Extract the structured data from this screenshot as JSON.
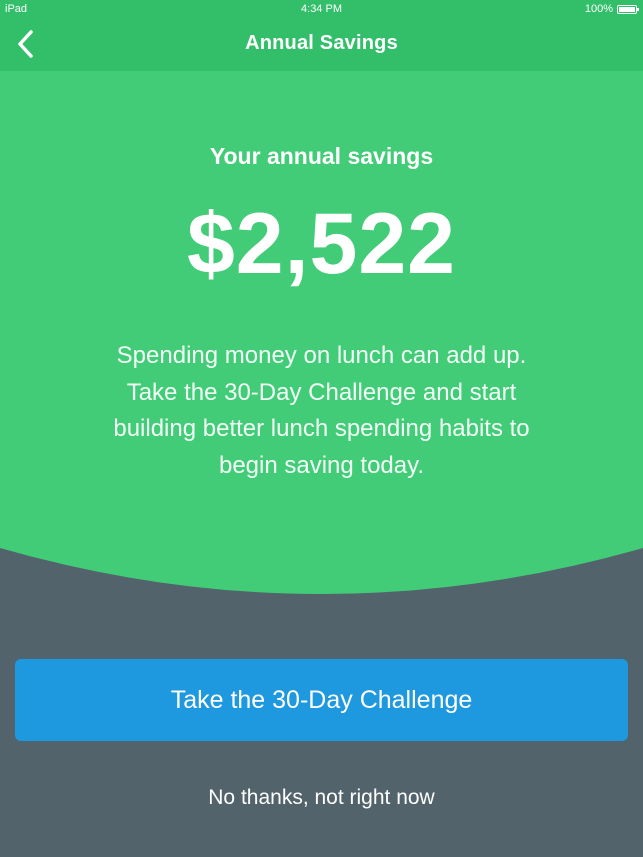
{
  "status_bar": {
    "device": "iPad",
    "time": "4:34 PM",
    "battery": "100%",
    "battery_level": 1.0
  },
  "nav": {
    "title": "Annual Savings",
    "back_icon": "chevron-left-icon"
  },
  "hero": {
    "heading": "Your annual savings",
    "amount": "$2,522",
    "description": "Spending money on lunch can add up. Take the 30-Day Challenge and start building better lunch spending habits to begin saving today."
  },
  "actions": {
    "primary_label": "Take the 30-Day Challenge",
    "secondary_label": "No thanks, not right now"
  },
  "colors": {
    "header_green": "#33bf6a",
    "hero_green": "#42cc78",
    "background_slate": "#52636b",
    "button_blue": "#1e98de",
    "text": "#ffffff"
  }
}
